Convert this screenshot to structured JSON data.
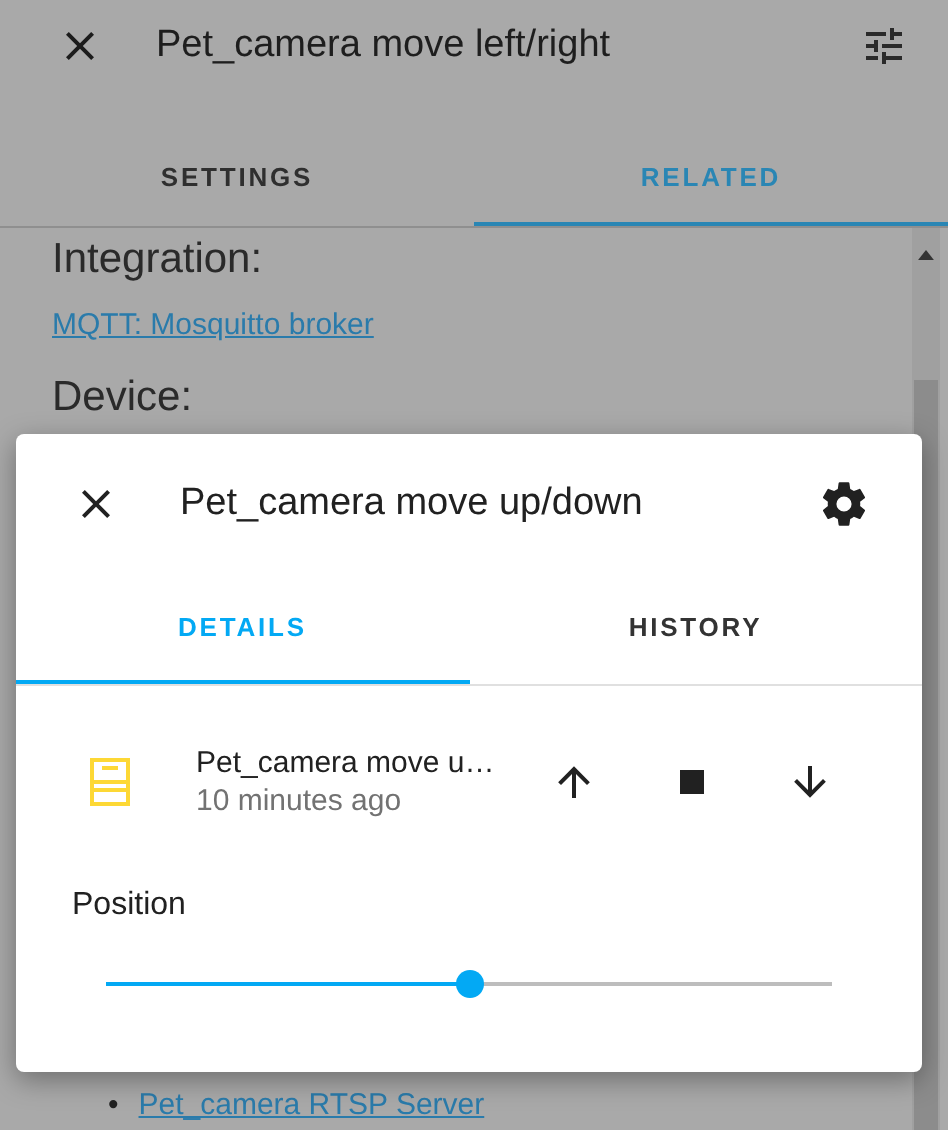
{
  "background_dialog": {
    "title": "Pet_camera move left/right",
    "tabs": [
      {
        "label": "SETTINGS",
        "selected": false
      },
      {
        "label": "RELATED",
        "selected": true
      }
    ],
    "sections": [
      {
        "heading": "Integration:",
        "links": [
          "MQTT: Mosquitto broker"
        ]
      },
      {
        "heading": "Device:",
        "list": [
          {
            "bullet": "•",
            "label": "Pet_camera RTSP Server"
          }
        ]
      }
    ]
  },
  "dialog": {
    "title": "Pet_camera move up/down",
    "tabs": [
      {
        "label": "DETAILS",
        "selected": true
      },
      {
        "label": "HISTORY",
        "selected": false
      }
    ],
    "entity": {
      "name": "Pet_camera move u…",
      "last_changed": "10 minutes ago"
    },
    "position": {
      "label": "Position",
      "level": 0.5
    }
  }
}
